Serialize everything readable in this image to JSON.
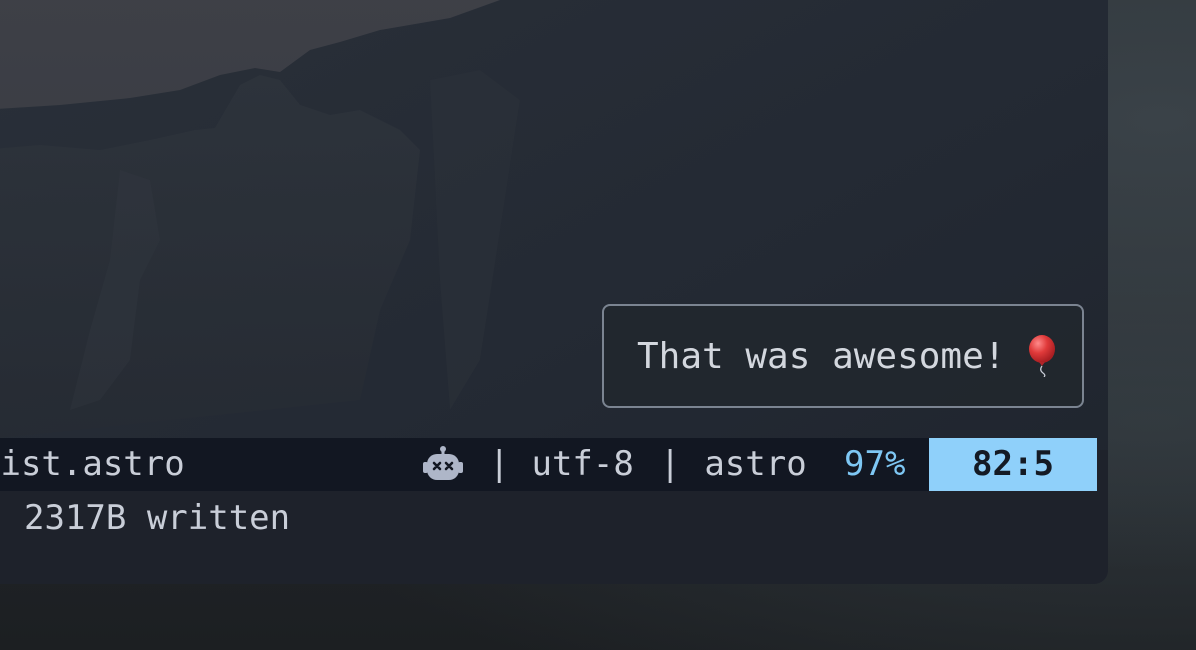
{
  "statusline": {
    "filename": "list.astro",
    "separator": "|",
    "encoding": "utf-8",
    "filetype": "astro",
    "percent": "97%",
    "position": "82:5",
    "filetype_icon": "robot-icon"
  },
  "message": {
    "text": "2317B written"
  },
  "notification": {
    "text": "That was awesome!",
    "icon": "balloon-icon"
  },
  "colors": {
    "accent": "#8fd0fa",
    "percent": "#7ec7f4",
    "statusline_bg": "#121722"
  }
}
